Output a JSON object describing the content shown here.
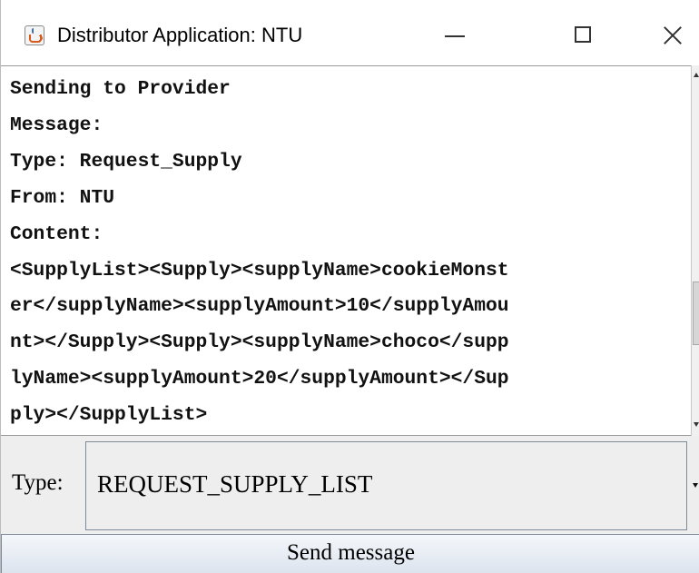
{
  "window": {
    "title": "Distributor Application: NTU",
    "icon": "java-cup-icon"
  },
  "log": {
    "lines": [
      "Sending to Provider",
      "Message:",
      "Type: Request_Supply",
      "From: NTU",
      "Content:",
      "<SupplyList><Supply><supplyName>cookieMonst",
      "er</supplyName><supplyAmount>10</supplyAmou",
      "nt></Supply><Supply><supplyName>choco</supp",
      "lyName><supplyAmount>20</supplyAmount></Sup",
      "ply></SupplyList>"
    ]
  },
  "type_selector": {
    "label": "Type:",
    "selected": "REQUEST_SUPPLY_LIST"
  },
  "send_button": {
    "label": "Send message"
  }
}
